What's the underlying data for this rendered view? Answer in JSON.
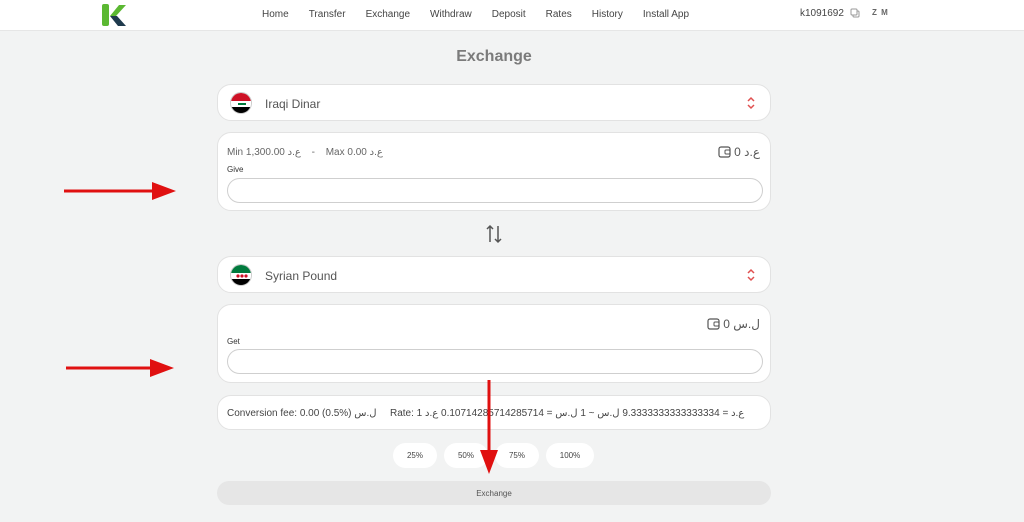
{
  "nav": {
    "items": [
      "Home",
      "Transfer",
      "Exchange",
      "Withdraw",
      "Deposit",
      "Rates",
      "History",
      "Install App"
    ]
  },
  "user": {
    "id": "k1091692",
    "initials": "Z M"
  },
  "page": {
    "title": "Exchange"
  },
  "from": {
    "currency": "Iraqi Dinar",
    "min_text": "Min 1,300.00 ع.د",
    "separator": "-",
    "max_text": "Max 0.00 ع.د",
    "balance": "ع.د 0",
    "label": "Give",
    "value": "",
    "placeholder": ""
  },
  "to": {
    "currency": "Syrian Pound",
    "balance": "ل.س 0",
    "label": "Get",
    "value": "",
    "placeholder": ""
  },
  "info": {
    "fee": "Conversion fee: 0.00 (0.5%) ل.س",
    "rate": "Rate: 1 ع.د = 9.3333333333333334 ل.س ~ 1 ل.س = 0.10714285714285714 ع.د"
  },
  "percent_buttons": [
    "25%",
    "50%",
    "75%",
    "100%"
  ],
  "exchange_button": "Exchange",
  "colors": {
    "accent": "#5bb832",
    "logo_dark": "#1f3a4d",
    "annotation": "#e01010"
  },
  "icons": {
    "swap": "swap-vertical-icon",
    "wallet": "wallet-icon",
    "chevron": "chevron-up-down-icon",
    "copy": "copy-icon"
  }
}
